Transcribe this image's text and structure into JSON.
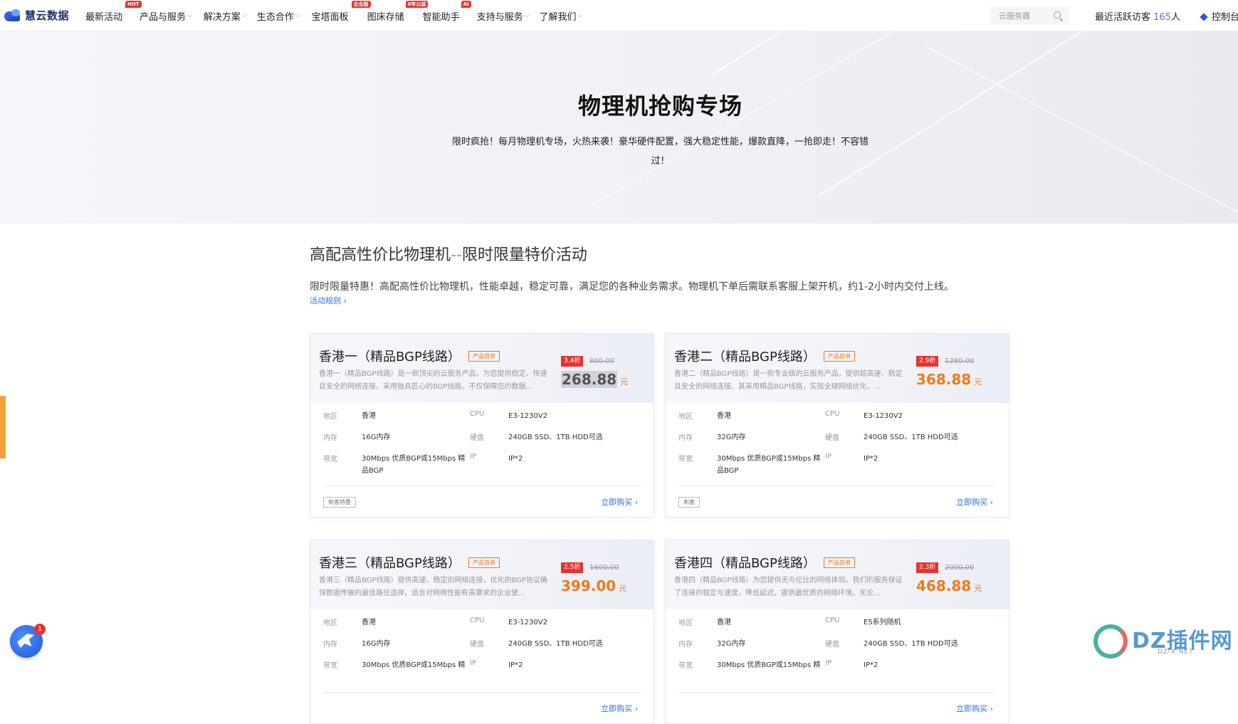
{
  "nav": {
    "logo": "慧云数据",
    "items": [
      {
        "label": "最新活动",
        "caret": false,
        "badge": "HOT"
      },
      {
        "label": "产品与服务",
        "caret": true,
        "badge": ""
      },
      {
        "label": "解决方案",
        "caret": true,
        "badge": ""
      },
      {
        "label": "生态合作",
        "caret": true,
        "badge": ""
      },
      {
        "label": "宝塔面板",
        "caret": false,
        "badge": "企业版"
      },
      {
        "label": "图床存储",
        "caret": false,
        "badge": "8年公益"
      },
      {
        "label": "智能助手",
        "caret": false,
        "badge": "AI"
      },
      {
        "label": "支持与服务",
        "caret": true,
        "badge": ""
      },
      {
        "label": "了解我们",
        "caret": true,
        "badge": ""
      }
    ],
    "search_placeholder": "云服务器",
    "visitors_prefix": "最近活跃访客",
    "visitors_count": "165",
    "visitors_suffix": "人",
    "console": "控制台"
  },
  "hero": {
    "title": "物理机抢购专场",
    "desc": "限时疯抢！每月物理机专场，火热来袭！豪华硬件配置，强大稳定性能，爆款直降，一抢即走！不容错过！"
  },
  "section": {
    "title_a": "高配高性价比物理机",
    "title_sep": "--",
    "title_b": "限时限量特价活动",
    "desc": "限时限量特惠！高配高性价比物理机，性能卓越，稳定可靠，满足您的各种业务需求。物理机下单后需联系客服上架开机，约1-2小时内交付上线。",
    "rules_link": "活动规则 ›"
  },
  "labels": {
    "region": "地区",
    "memory": "内存",
    "bandwidth": "带宽",
    "cpu": "CPU",
    "disk": "硬盘",
    "ip": "IP",
    "currency": "元",
    "buy": "立即购买 ›"
  },
  "cards": [
    {
      "name": "香港一（精品BGP线路）",
      "tag": "产品首单",
      "desc": "香港一（精品BGP线路）是一款顶尖的云服务产品，为您提供稳定、快速且安全的网络连接。采用独具匠心的BGP线路，不仅保障您的数据...",
      "discount": "3.4折",
      "original": "800.00",
      "price": "268.88",
      "region": "香港",
      "memory": "16G内存",
      "bandwidth": "30Mbps 优质BGP或15Mbps 精品BGP",
      "cpu": "E3-1230V2",
      "disk": "240GB SSD、1TB HDD可选",
      "ip": "IP*2",
      "foot_tag": "新客特惠",
      "price_selected": true
    },
    {
      "name": "香港二（精品BGP线路）",
      "tag": "产品首单",
      "desc": "香港二（精品BGP线路）是一款专业级的云服务产品，提供超高速、稳定且安全的网络连接。其采用精品BGP线路，实现全球网络优化，...",
      "discount": "2.9折",
      "original": "1280.00",
      "price": "368.88",
      "region": "香港",
      "memory": "32G内存",
      "bandwidth": "30Mbps 优质BGP或15Mbps 精品BGP",
      "cpu": "E3-1230V2",
      "disk": "240GB SSD、1TB HDD可选",
      "ip": "IP*2",
      "foot_tag": "新客",
      "price_selected": false
    },
    {
      "name": "香港三（精品BGP线路）",
      "tag": "产品首单",
      "desc": "香港三（精品BGP线路）提供高速、稳定的网络连接，优化的BGP协议确保数据传输的最佳路径选择，适合对网络性能有高要求的企业使...",
      "discount": "2.5折",
      "original": "1600.00",
      "price": "399.00",
      "region": "香港",
      "memory": "16G内存",
      "bandwidth": "30Mbps 优质BGP或15Mbps 精",
      "cpu": "E3-1230V2",
      "disk": "240GB SSD、1TB HDD可选",
      "ip": "IP*2",
      "foot_tag": "",
      "price_selected": false
    },
    {
      "name": "香港四（精品BGP线路）",
      "tag": "产品首单",
      "desc": "香港四（精品BGP线路）为您提供无与伦比的网络体验。我们的服务保证了连接的稳定与速度，降低延迟，提供最优质的网络环境。无论...",
      "discount": "2.3折",
      "original": "2000.00",
      "price": "468.88",
      "region": "香港",
      "memory": "32G内存",
      "bandwidth": "30Mbps 优质BGP或15Mbps 精",
      "cpu": "E5系列随机",
      "disk": "240GB SSD、1TB HDD可选",
      "ip": "IP*2",
      "foot_tag": "",
      "price_selected": false
    }
  ],
  "float": {
    "badge": "1"
  },
  "watermark": {
    "text": "DZ插件网",
    "sub": "DZ-X.NET"
  },
  "colors": {
    "accent": "#2d6de5",
    "price": "#f07a1a",
    "discount": "#e8322d"
  }
}
